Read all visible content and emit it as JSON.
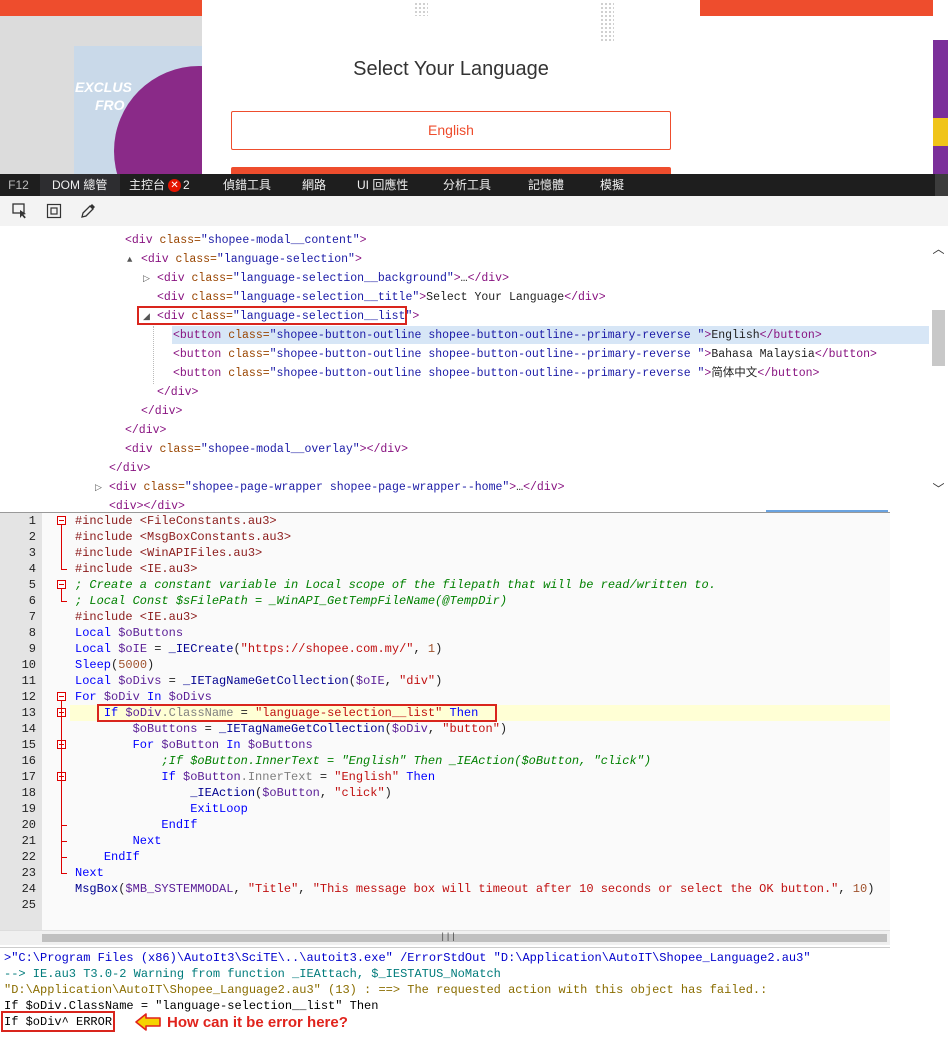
{
  "browser": {
    "modal_title": "Select Your Language",
    "english_button": "English",
    "promo_line1": "EXCLUS",
    "promo_line2": "FRO"
  },
  "devtools": {
    "tabs": [
      "F12",
      "DOM 總管",
      "主控台",
      "偵錯工具",
      "網路",
      "UI 回應性",
      "分析工具",
      "記憶體",
      "模擬"
    ],
    "console_error_count": "2",
    "tool_icons": [
      "select-element-icon",
      "highlight-box-icon",
      "color-picker-icon"
    ],
    "dom_lines": [
      {
        "indent": 0,
        "tri": "",
        "tag": "div",
        "attrs": [
          [
            "class",
            "shopee-modal__content"
          ]
        ],
        "text": "",
        "close": ""
      },
      {
        "indent": 1,
        "tri": "▲",
        "tag": "div",
        "attrs": [
          [
            "class",
            "language-selection"
          ]
        ],
        "text": "",
        "close": ""
      },
      {
        "indent": 2,
        "tri": "▷",
        "tag": "div",
        "attrs": [
          [
            "class",
            "language-selection__background"
          ]
        ],
        "text": "…",
        "close": "div"
      },
      {
        "indent": 2,
        "tri": "",
        "tag": "div",
        "attrs": [
          [
            "class",
            "language-selection__title"
          ]
        ],
        "text": "Select Your Language",
        "close": "div"
      },
      {
        "indent": 2,
        "tri": "◢",
        "tag": "div",
        "attrs": [
          [
            "class",
            "language-selection__list"
          ]
        ],
        "text": "",
        "close": ""
      },
      {
        "indent": 3,
        "tri": "",
        "tag": "button",
        "attrs": [
          [
            "class",
            "shopee-button-outline shopee-button-outline--primary-reverse "
          ]
        ],
        "text": "English",
        "close": "button"
      },
      {
        "indent": 3,
        "tri": "",
        "tag": "button",
        "attrs": [
          [
            "class",
            "shopee-button-outline shopee-button-outline--primary-reverse "
          ]
        ],
        "text": "Bahasa Malaysia",
        "close": "button"
      },
      {
        "indent": 3,
        "tri": "",
        "tag": "button",
        "attrs": [
          [
            "class",
            "shopee-button-outline shopee-button-outline--primary-reverse "
          ]
        ],
        "text": "简体中文",
        "close": "button"
      },
      {
        "indent": 2,
        "tri": "",
        "closing_only": "div"
      },
      {
        "indent": 1,
        "tri": "",
        "closing_only": "div"
      },
      {
        "indent": 0,
        "tri": "",
        "closing_only": "div"
      },
      {
        "indent": 0,
        "tri": "",
        "tag": "div",
        "attrs": [
          [
            "class",
            "shopee-modal__overlay"
          ]
        ],
        "text": "",
        "close": "div"
      },
      {
        "indent": -1,
        "tri": "",
        "closing_only": "div"
      },
      {
        "indent": -1,
        "tri": "▷",
        "tag": "div",
        "attrs": [
          [
            "class",
            "shopee-page-wrapper shopee-page-wrapper--home"
          ]
        ],
        "text": "…",
        "close": "div"
      },
      {
        "indent": -1,
        "tri": "",
        "tag": "div",
        "attrs": [],
        "text": "",
        "close": "div"
      }
    ]
  },
  "editor": {
    "line_numbers": [
      "1",
      "2",
      "3",
      "4",
      "5",
      "6",
      "7",
      "8",
      "9",
      "10",
      "11",
      "12",
      "13",
      "14",
      "15",
      "16",
      "17",
      "18",
      "19",
      "20",
      "21",
      "22",
      "23",
      "24",
      "25"
    ],
    "lines": [
      [
        [
          "inc",
          "#include <FileConstants.au3>"
        ]
      ],
      [
        [
          "inc",
          "#include <MsgBoxConstants.au3>"
        ]
      ],
      [
        [
          "inc",
          "#include <WinAPIFiles.au3>"
        ]
      ],
      [
        [
          "inc",
          "#include <IE.au3>"
        ]
      ],
      [
        [
          "cmt",
          "; Create a constant variable in Local scope of the filepath that will be read/written to."
        ]
      ],
      [
        [
          "cmt",
          "; Local Const $sFilePath = _WinAPI_GetTempFileName(@TempDir)"
        ]
      ],
      [
        [
          "inc",
          "#include <IE.au3>"
        ]
      ],
      [
        [
          "kw",
          "Local "
        ],
        [
          "var",
          "$oButtons"
        ]
      ],
      [
        [
          "kw",
          "Local "
        ],
        [
          "var",
          "$oIE"
        ],
        [
          "plain",
          " = "
        ],
        [
          "fn",
          "_IECreate"
        ],
        [
          "plain",
          "("
        ],
        [
          "str",
          "\"https://shopee.com.my/\""
        ],
        [
          "plain",
          ", "
        ],
        [
          "num",
          "1"
        ],
        [
          "plain",
          ")"
        ]
      ],
      [
        [
          "kw",
          "Sleep"
        ],
        [
          "plain",
          "("
        ],
        [
          "num",
          "5000"
        ],
        [
          "plain",
          ")"
        ]
      ],
      [
        [
          "kw",
          "Local "
        ],
        [
          "var",
          "$oDivs"
        ],
        [
          "plain",
          " = "
        ],
        [
          "fn",
          "_IETagNameGetCollection"
        ],
        [
          "plain",
          "("
        ],
        [
          "var",
          "$oIE"
        ],
        [
          "plain",
          ", "
        ],
        [
          "str",
          "\"div\""
        ],
        [
          "plain",
          ")"
        ]
      ],
      [
        [
          "kw",
          "For "
        ],
        [
          "var",
          "$oDiv"
        ],
        [
          "kw",
          " In "
        ],
        [
          "var",
          "$oDivs"
        ]
      ],
      [
        [
          "plain",
          "    "
        ],
        [
          "kw",
          "If "
        ],
        [
          "var",
          "$oDiv"
        ],
        [
          "prop",
          ".ClassName"
        ],
        [
          "plain",
          " = "
        ],
        [
          "str",
          "\"language-selection__list\""
        ],
        [
          "kw",
          " Then"
        ]
      ],
      [
        [
          "plain",
          "        "
        ],
        [
          "var",
          "$oButtons"
        ],
        [
          "plain",
          " = "
        ],
        [
          "fn",
          "_IETagNameGetCollection"
        ],
        [
          "plain",
          "("
        ],
        [
          "var",
          "$oDiv"
        ],
        [
          "plain",
          ", "
        ],
        [
          "str",
          "\"button\""
        ],
        [
          "plain",
          ")"
        ]
      ],
      [
        [
          "plain",
          "        "
        ],
        [
          "kw",
          "For "
        ],
        [
          "var",
          "$oButton"
        ],
        [
          "kw",
          " In "
        ],
        [
          "var",
          "$oButtons"
        ]
      ],
      [
        [
          "plain",
          "            "
        ],
        [
          "cmt",
          ";If $oButton.InnerText = \"English\" Then _IEAction($oButton, \"click\")"
        ]
      ],
      [
        [
          "plain",
          "            "
        ],
        [
          "kw",
          "If "
        ],
        [
          "var",
          "$oButton"
        ],
        [
          "prop",
          ".InnerText"
        ],
        [
          "plain",
          " = "
        ],
        [
          "str",
          "\"English\""
        ],
        [
          "kw",
          " Then"
        ]
      ],
      [
        [
          "plain",
          "                "
        ],
        [
          "fn",
          "_IEAction"
        ],
        [
          "plain",
          "("
        ],
        [
          "var",
          "$oButton"
        ],
        [
          "plain",
          ", "
        ],
        [
          "str",
          "\"click\""
        ],
        [
          "plain",
          ")"
        ]
      ],
      [
        [
          "plain",
          "                "
        ],
        [
          "kw",
          "ExitLoop"
        ]
      ],
      [
        [
          "plain",
          "            "
        ],
        [
          "kw",
          "EndIf"
        ]
      ],
      [
        [
          "plain",
          "        "
        ],
        [
          "kw",
          "Next"
        ]
      ],
      [
        [
          "plain",
          "    "
        ],
        [
          "kw",
          "EndIf"
        ]
      ],
      [
        [
          "kw",
          "Next"
        ]
      ],
      [
        [
          "fn",
          "MsgBox"
        ],
        [
          "plain",
          "("
        ],
        [
          "var",
          "$MB_SYSTEMMODAL"
        ],
        [
          "plain",
          ", "
        ],
        [
          "str",
          "\"Title\""
        ],
        [
          "plain",
          ", "
        ],
        [
          "str",
          "\"This message box will timeout after 10 seconds or select the OK button.\""
        ],
        [
          "plain",
          ", "
        ],
        [
          "num",
          "10"
        ],
        [
          "plain",
          ")"
        ]
      ],
      []
    ],
    "hscroll_grip": "|||"
  },
  "output": {
    "lines": [
      {
        "cls": "blue",
        "text": ">\"C:\\Program Files (x86)\\AutoIt3\\SciTE\\..\\autoit3.exe\" /ErrorStdOut \"D:\\Application\\AutoIT\\Shopee_Language2.au3\""
      },
      {
        "cls": "teal",
        "text": "--> IE.au3 T3.0-2 Warning from function _IEAttach, $_IESTATUS_NoMatch"
      },
      {
        "cls": "olive",
        "text": "\"D:\\Application\\AutoIT\\Shopee_Language2.au3\" (13) : ==> The requested action with this object has failed.:"
      },
      {
        "cls": "black",
        "text": "If $oDiv.ClassName = \"language-selection__list\" Then"
      },
      {
        "cls": "black",
        "text": "If $oDiv^ ERROR"
      }
    ],
    "annotation": "How can it be error here?",
    "annotation_color": "#e0231c"
  }
}
